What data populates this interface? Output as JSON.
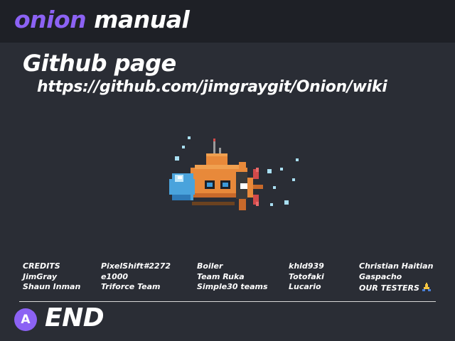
{
  "header": {
    "brand_primary": "onion",
    "brand_secondary": "manual"
  },
  "page": {
    "title": "Github page",
    "url": "https://github.com/jimgraygit/Onion/wiki"
  },
  "credits": {
    "columns": [
      [
        "CREDITS",
        "JimGray",
        "Shaun Inman"
      ],
      [
        "PixelShift#2272",
        "e1000",
        "Triforce Team"
      ],
      [
        "Boiler",
        "Team Ruka",
        "Simple30 teams"
      ],
      [
        "khld939",
        "Totofaki",
        "Lucario"
      ],
      [
        "Christian Haitian",
        "Gaspacho",
        "OUR TESTERS"
      ]
    ]
  },
  "footer": {
    "button_glyph": "A",
    "action_label": "END"
  },
  "icons": {
    "illustration": "submarine-icon",
    "testers": "praying-hands-icon"
  },
  "colors": {
    "accent": "#8c62f4",
    "background": "#2a2d35",
    "header_bg": "#1e2026"
  }
}
